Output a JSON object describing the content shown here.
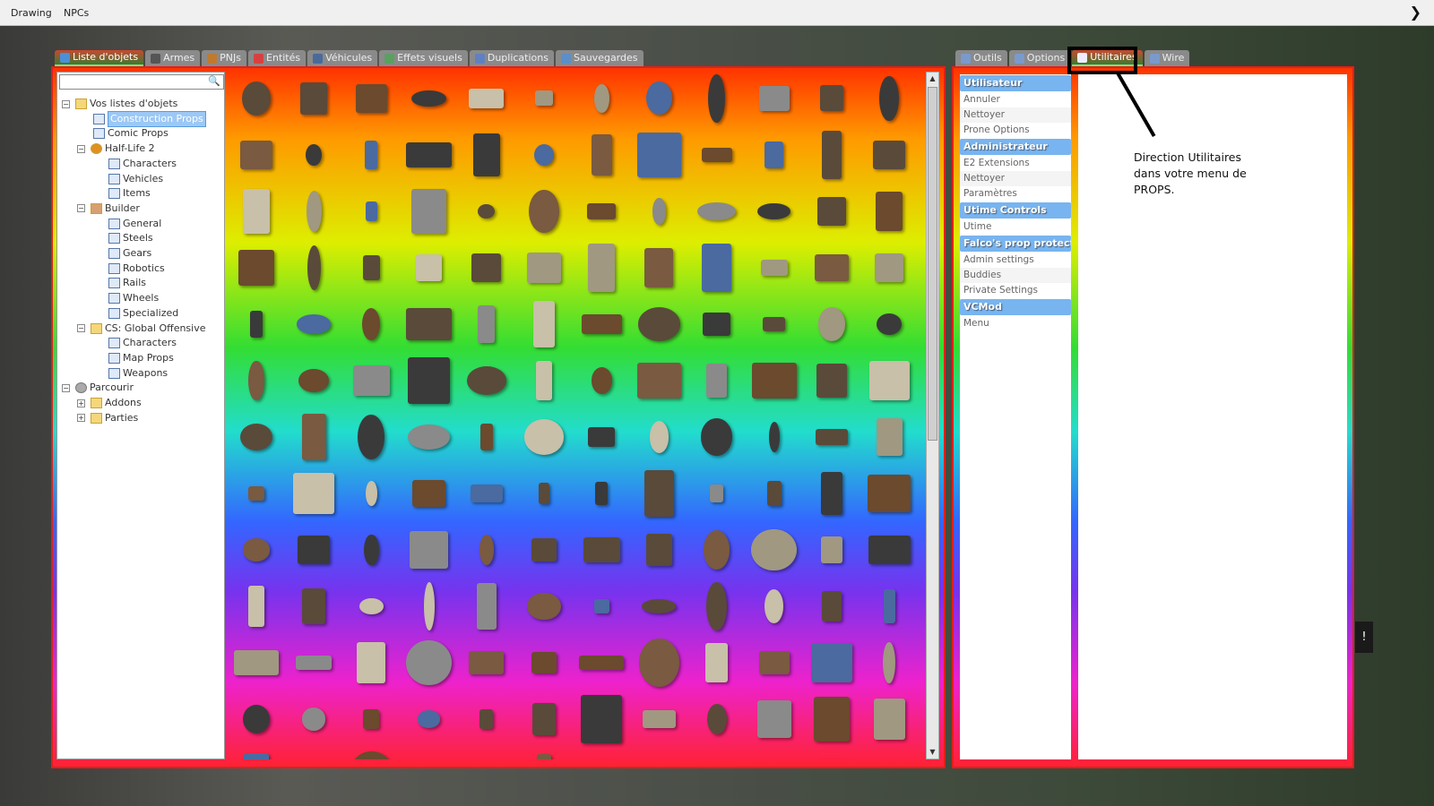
{
  "topbar": {
    "menus": [
      "Drawing",
      "NPCs"
    ]
  },
  "left_tabs": [
    {
      "label": "Liste d'objets",
      "icon": "grid-icon",
      "active": true,
      "color": "#4a90d9"
    },
    {
      "label": "Armes",
      "icon": "gun-icon",
      "color": "#555555"
    },
    {
      "label": "PNJs",
      "icon": "monkey-icon",
      "color": "#c07a30"
    },
    {
      "label": "Entités",
      "icon": "entity-icon",
      "color": "#d84040"
    },
    {
      "label": "Véhicules",
      "icon": "car-icon",
      "color": "#4a6a9a"
    },
    {
      "label": "Effets visuels",
      "icon": "image-icon",
      "color": "#5aa060"
    },
    {
      "label": "Duplications",
      "icon": "dupe-icon",
      "color": "#6080c0"
    },
    {
      "label": "Sauvegardes",
      "icon": "save-icon",
      "color": "#5b8fc8"
    }
  ],
  "search": {
    "placeholder": ""
  },
  "tree": [
    {
      "label": "Vos listes d'objets",
      "level": 0,
      "toggle": "−",
      "type": "folder"
    },
    {
      "label": "Construction Props",
      "level": 1,
      "type": "page",
      "selected": true
    },
    {
      "label": "Comic Props",
      "level": 1,
      "type": "page"
    },
    {
      "label": "Half-Life 2",
      "level": 1,
      "toggle": "−",
      "type": "hl2"
    },
    {
      "label": "Characters",
      "level": 2,
      "type": "page"
    },
    {
      "label": "Vehicles",
      "level": 2,
      "type": "page"
    },
    {
      "label": "Items",
      "level": 2,
      "type": "page"
    },
    {
      "label": "Builder",
      "level": 1,
      "toggle": "−",
      "type": "wrench"
    },
    {
      "label": "General",
      "level": 2,
      "type": "page"
    },
    {
      "label": "Steels",
      "level": 2,
      "type": "page"
    },
    {
      "label": "Gears",
      "level": 2,
      "type": "page"
    },
    {
      "label": "Robotics",
      "level": 2,
      "type": "page"
    },
    {
      "label": "Rails",
      "level": 2,
      "type": "page"
    },
    {
      "label": "Wheels",
      "level": 2,
      "type": "page"
    },
    {
      "label": "Specialized",
      "level": 2,
      "type": "page"
    },
    {
      "label": "CS: Global Offensive",
      "level": 1,
      "toggle": "−",
      "type": "folder"
    },
    {
      "label": "Characters",
      "level": 2,
      "type": "page"
    },
    {
      "label": "Map Props",
      "level": 2,
      "type": "page"
    },
    {
      "label": "Weapons",
      "level": 2,
      "type": "page"
    },
    {
      "label": "Parcourir",
      "level": 0,
      "toggle": "−",
      "type": "gear"
    },
    {
      "label": "Addons",
      "level": 1,
      "toggle": "+",
      "type": "folder"
    },
    {
      "label": "Parties",
      "level": 1,
      "toggle": "+",
      "type": "folder"
    }
  ],
  "right_tabs": [
    {
      "label": "Outils",
      "icon": "wrench-icon"
    },
    {
      "label": "Options",
      "icon": "wrench-icon"
    },
    {
      "label": "Utilitaires",
      "icon": "utilities-icon",
      "active": true
    },
    {
      "label": "Wire",
      "icon": "wrench-icon"
    }
  ],
  "categories": [
    {
      "title": "Utilisateur",
      "items": [
        "Annuler",
        "Nettoyer",
        "Prone Options"
      ]
    },
    {
      "title": "Administrateur",
      "items": [
        "E2 Extensions",
        "Nettoyer",
        "Paramètres"
      ]
    },
    {
      "title": "Utime Controls",
      "items": [
        "Utime"
      ]
    },
    {
      "title": "Falco's prop protect...",
      "items": [
        "Admin settings",
        "Buddies",
        "Private Settings"
      ]
    },
    {
      "title": "VCMod",
      "items": [
        "Menu"
      ]
    }
  ],
  "annotation": {
    "text": "Direction Utilitaires dans votre menu de PROPS."
  },
  "toast": {
    "text": "!"
  },
  "colors": {
    "tab_active": "#3c7a32",
    "category_header": "#78b4f0",
    "frame_border": "#e0201a"
  }
}
